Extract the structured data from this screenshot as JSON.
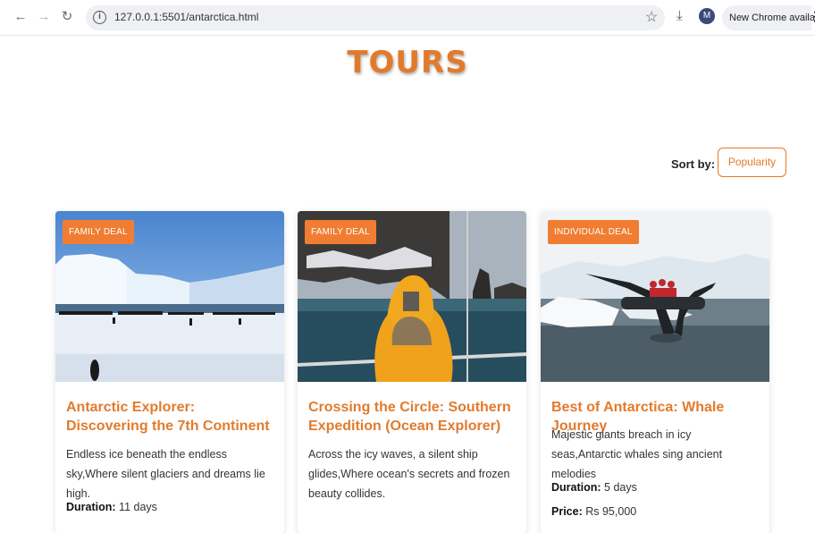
{
  "browser": {
    "url": "127.0.0.1:5501/antarctica.html",
    "update_label": "New Chrome available",
    "avatar_letter": "M"
  },
  "page": {
    "title": "TOURS",
    "sort_label": "Sort by:",
    "sort_value": "Popularity"
  },
  "colors": {
    "accent": "#e37a2b",
    "badge": "#f07d32"
  },
  "tours": [
    {
      "badge": "FAMILY DEAL",
      "title": "Antarctic Explorer: Discovering the 7th Continent",
      "description": "Endless ice beneath the endless sky,Where silent glaciers and dreams lie high.",
      "duration_label": "Duration:",
      "duration": "11 days"
    },
    {
      "badge": "FAMILY DEAL",
      "title": "Crossing the Circle: Southern Expedition (Ocean Explorer)",
      "description": "Across the icy waves, a silent ship glides,Where ocean's secrets and frozen beauty collides."
    },
    {
      "badge": "INDIVIDUAL DEAL",
      "title": "Best of Antarctica: Whale Journey",
      "description": "Majestic giants breach in icy seas,Antarctic whales sing ancient melodies",
      "duration_label": "Duration:",
      "duration": "5 days",
      "price_label": "Price:",
      "price": "Rs 95,000"
    }
  ]
}
